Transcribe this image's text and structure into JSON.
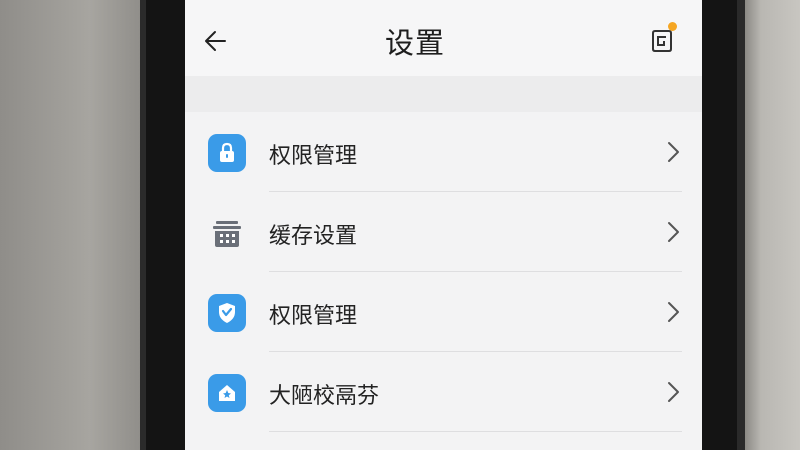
{
  "header": {
    "title": "设置",
    "back_icon": "arrow-left-icon",
    "feedback_icon": "feedback-icon"
  },
  "colors": {
    "accent_blue": "#3a9be8",
    "gray_icon": "#6a6f78",
    "notification_dot": "#f5a623"
  },
  "settings": {
    "items": [
      {
        "label": "权限管理",
        "icon": "lock-icon"
      },
      {
        "label": "缓存设置",
        "icon": "trash-icon"
      },
      {
        "label": "权限管理",
        "icon": "shield-icon"
      },
      {
        "label": "大陋校鬲芬",
        "icon": "house-icon"
      }
    ]
  }
}
